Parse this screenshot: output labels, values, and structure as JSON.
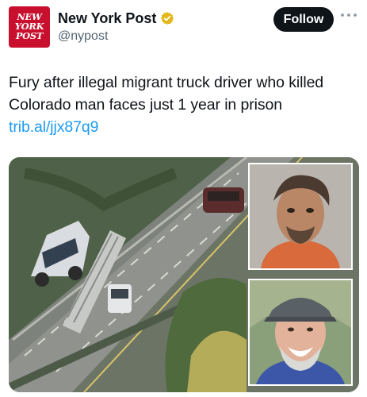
{
  "account": {
    "avatar_text": [
      "NEW",
      "YORK",
      "POST"
    ],
    "display_name": "New York Post",
    "handle": "@nypost",
    "verified_badge_color": "#e2b719"
  },
  "actions": {
    "follow_label": "Follow",
    "more_icon": "ellipsis-icon"
  },
  "tweet": {
    "text": "Fury after illegal migrant truck driver who killed Colorado man faces just 1 year in prison ",
    "link": "trib.al/jjx87q9"
  },
  "colors": {
    "accent_link": "#1d9bf0",
    "follow_bg": "#0f1419",
    "brand_red": "#c8102e"
  }
}
